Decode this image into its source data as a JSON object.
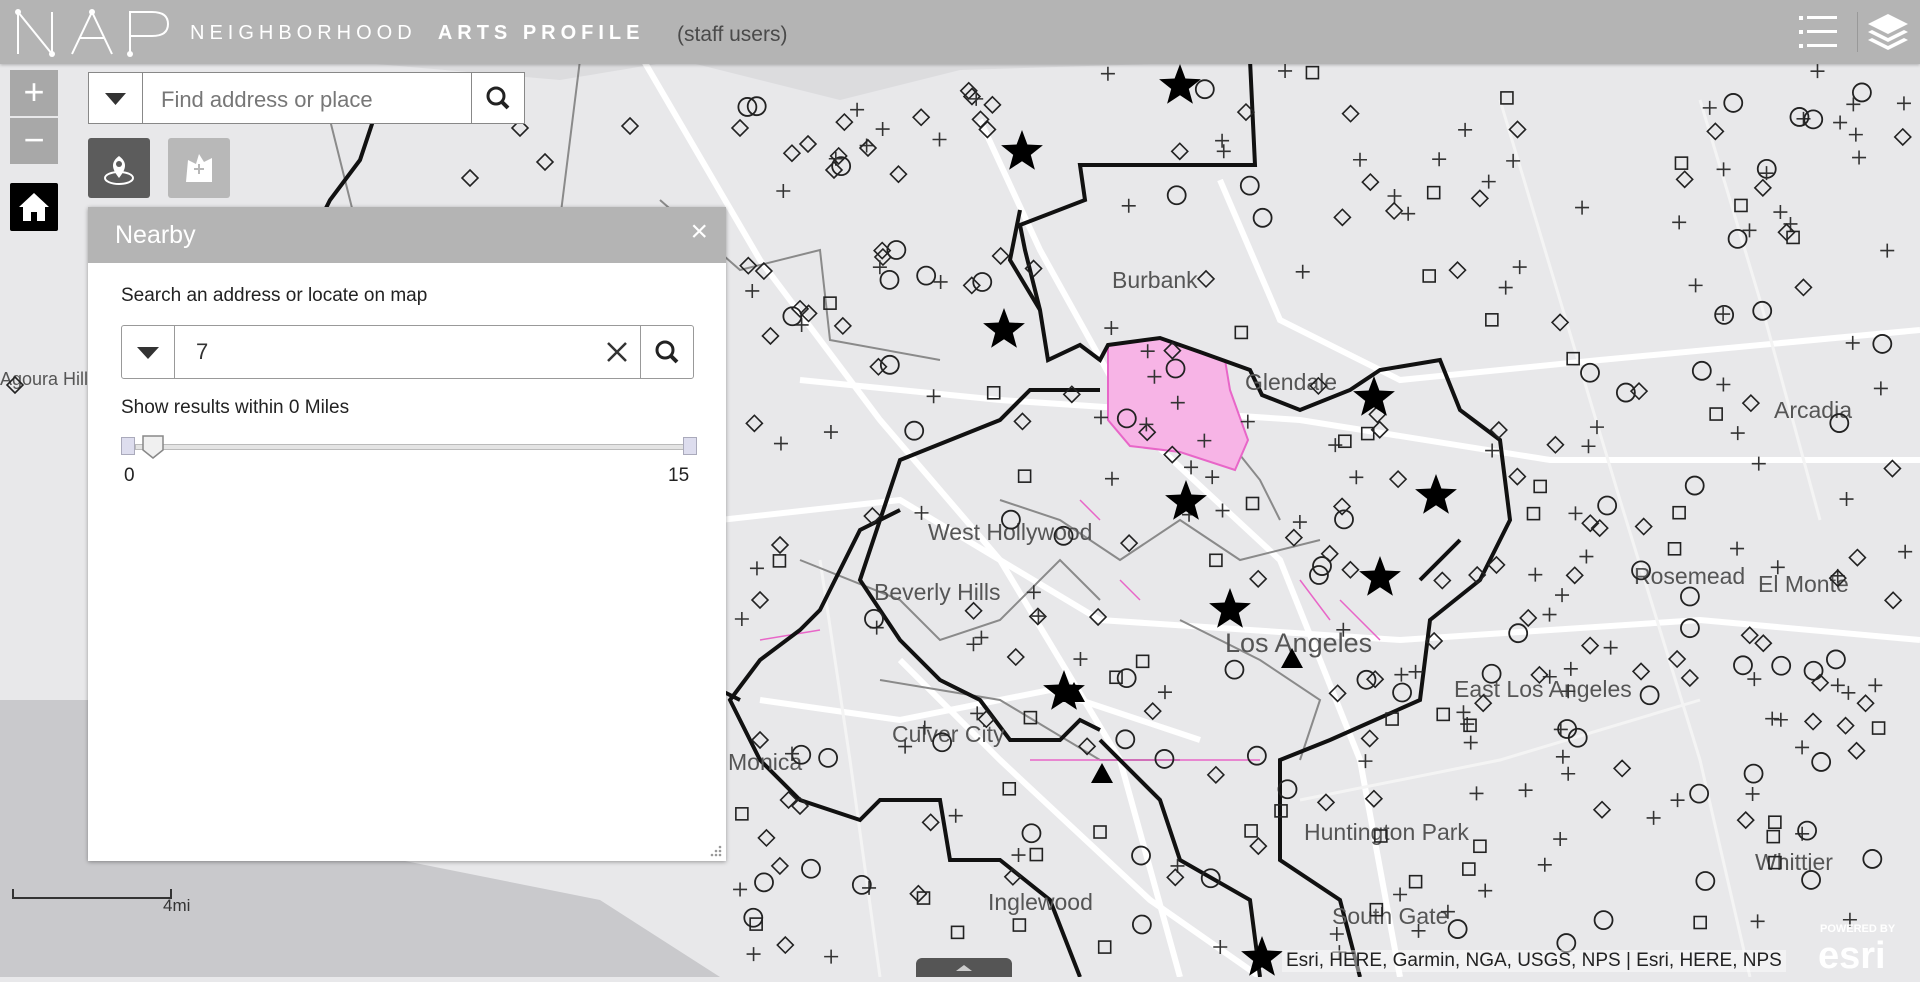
{
  "header": {
    "logo_text": "NAP",
    "title_light": "NEIGHBORHOOD",
    "title_bold": "ARTS PROFILE",
    "subtitle": "(staff users)"
  },
  "icons": {
    "list": "list-icon",
    "layers": "layers-icon",
    "home": "home-icon",
    "search": "search-icon",
    "locate": "locate-icon",
    "draw": "draw-area-icon"
  },
  "zoom": {
    "in_label": "+",
    "out_label": "−"
  },
  "search": {
    "placeholder": "Find address or place"
  },
  "panel": {
    "title": "Nearby",
    "close": "×",
    "instruction": "Search an address or locate on map",
    "input_value": "7",
    "radius_label": "Show results within 0 Miles",
    "slider": {
      "min": "0",
      "max": "15",
      "value": 0
    }
  },
  "map": {
    "labels": [
      "Burbank",
      "Glendale",
      "Arcadia",
      "Agoura Hills",
      "West Hollywood",
      "Beverly Hills",
      "Los Angeles",
      "Rosemead",
      "El Monte",
      "East Los Angeles",
      "Culver City",
      "Monica",
      "Huntington Park",
      "Whittier",
      "Inglewood",
      "South Gate"
    ],
    "scale_label": "4mi",
    "attribution": "Esri, HERE, Garmin, NGA, USGS, NPS | Esri, HERE, NPS",
    "esri_powered": "POWERED BY",
    "esri_text": "esri"
  },
  "colors": {
    "header_bg": "#b4b4b4",
    "map_bg": "#e8e8ea",
    "highlight_pink": "#f7b4e6",
    "boundary": "#111111"
  }
}
